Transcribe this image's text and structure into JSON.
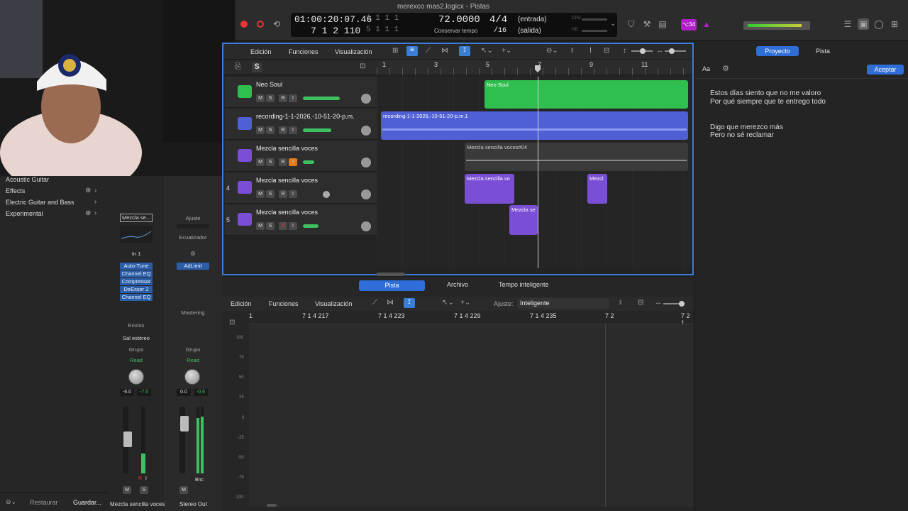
{
  "window": {
    "title": "merexco mas2.logicx - Pistas"
  },
  "lcd": {
    "time": "01:00:20:07.46",
    "bars": "1   1   1   1",
    "position": "7  1  2  110",
    "bars2": "5   1   1   1",
    "tempo": "72.0000",
    "tempo_mode": "Conservar tempo",
    "sig": "4/4",
    "division": "/16",
    "input": "(entrada)",
    "output": "(salida)",
    "cpu": "CPU",
    "hd": "HD"
  },
  "toolbar_right": {
    "badge": "⌥34"
  },
  "library": {
    "items": [
      {
        "label": "Acoustic Guitar"
      },
      {
        "label": "Effects"
      },
      {
        "label": "Electric Guitar and Bass"
      },
      {
        "label": "Experimental"
      }
    ],
    "restore_label": "Restaurar",
    "save_label": "Guardar..."
  },
  "inspector": {
    "strip1": {
      "name_box": "Mezcla se...",
      "input": "In 1",
      "plugins": [
        "Auto-Tune",
        "Channel EQ",
        "Compressor",
        "DeEsser 2",
        "Channel EQ"
      ],
      "sends": "Envíos",
      "output": "Sal estéreo",
      "group": "Grupo",
      "automation": "Read",
      "vol1": "-6.0",
      "vol2": "-7.5",
      "name": "Mezcla sencilla voces",
      "m": "M",
      "s": "S",
      "r": "R",
      "i": "I"
    },
    "strip2": {
      "name_box": "Ajuste",
      "eq": "Ecualizador",
      "plugins": [
        "AdLimit"
      ],
      "mastering": "Mastering",
      "group": "Grupo",
      "automation": "Read",
      "vol1": "0.0",
      "vol2": "-0.6",
      "bnc": "Bnc",
      "name": "Stereo Out",
      "m": "M"
    }
  },
  "tracks_toolbar": {
    "edit": "Edición",
    "functions": "Funciones",
    "view": "Visualización"
  },
  "ruler": {
    "marks": [
      "1",
      "3",
      "5",
      "7",
      "9",
      "11"
    ]
  },
  "tracks": [
    {
      "num": "",
      "name": "Neo Soul",
      "color": "#2fbf4f"
    },
    {
      "num": "",
      "name": "recording-1-1-2026,-10-51-20-p.m.",
      "color": "#4f5fd6"
    },
    {
      "num": "",
      "name": "Mezcla sencilla voces",
      "color": "#7a4fd6"
    },
    {
      "num": "4",
      "name": "Mezcla sencilla voces",
      "color": "#7a4fd6"
    },
    {
      "num": "5",
      "name": "Mezcla sencilla voces",
      "color": "#7a4fd6"
    }
  ],
  "regions": {
    "neo": "Neo Soul",
    "rec": "recording-1-1-2026,-10-51-20-p.m.1",
    "mez3": "Mezcla sencilla voces#04",
    "mez4a": "Mezcla sencilla vo",
    "mez4b": "Mezcl",
    "mez5": "Mezcla se"
  },
  "tabs": {
    "track": "Pista",
    "file": "Archivo",
    "smart": "Tempo inteligente"
  },
  "editor": {
    "edit": "Edición",
    "functions": "Funciones",
    "view": "Visualización",
    "snap_label": "Ajuste:",
    "snap_value": "Inteligente",
    "ruler": [
      "1",
      "7 1 4 217",
      "7 1 4 223",
      "7 1 4 229",
      "7 1 4 235",
      "7 2",
      "7 2 1"
    ],
    "scale": [
      "100",
      "75",
      "50",
      "25",
      "0",
      "-25",
      "-50",
      "-75",
      "-100"
    ]
  },
  "right": {
    "tab_project": "Proyecto",
    "tab_track": "Pista",
    "aa": "Aa",
    "accept": "Aceptar",
    "lyrics": [
      "Estos días siento que no me valoro",
      "Por qué siempre que te entrego todo",
      "Digo que merezco más",
      "Pero no sé reclamar"
    ]
  }
}
